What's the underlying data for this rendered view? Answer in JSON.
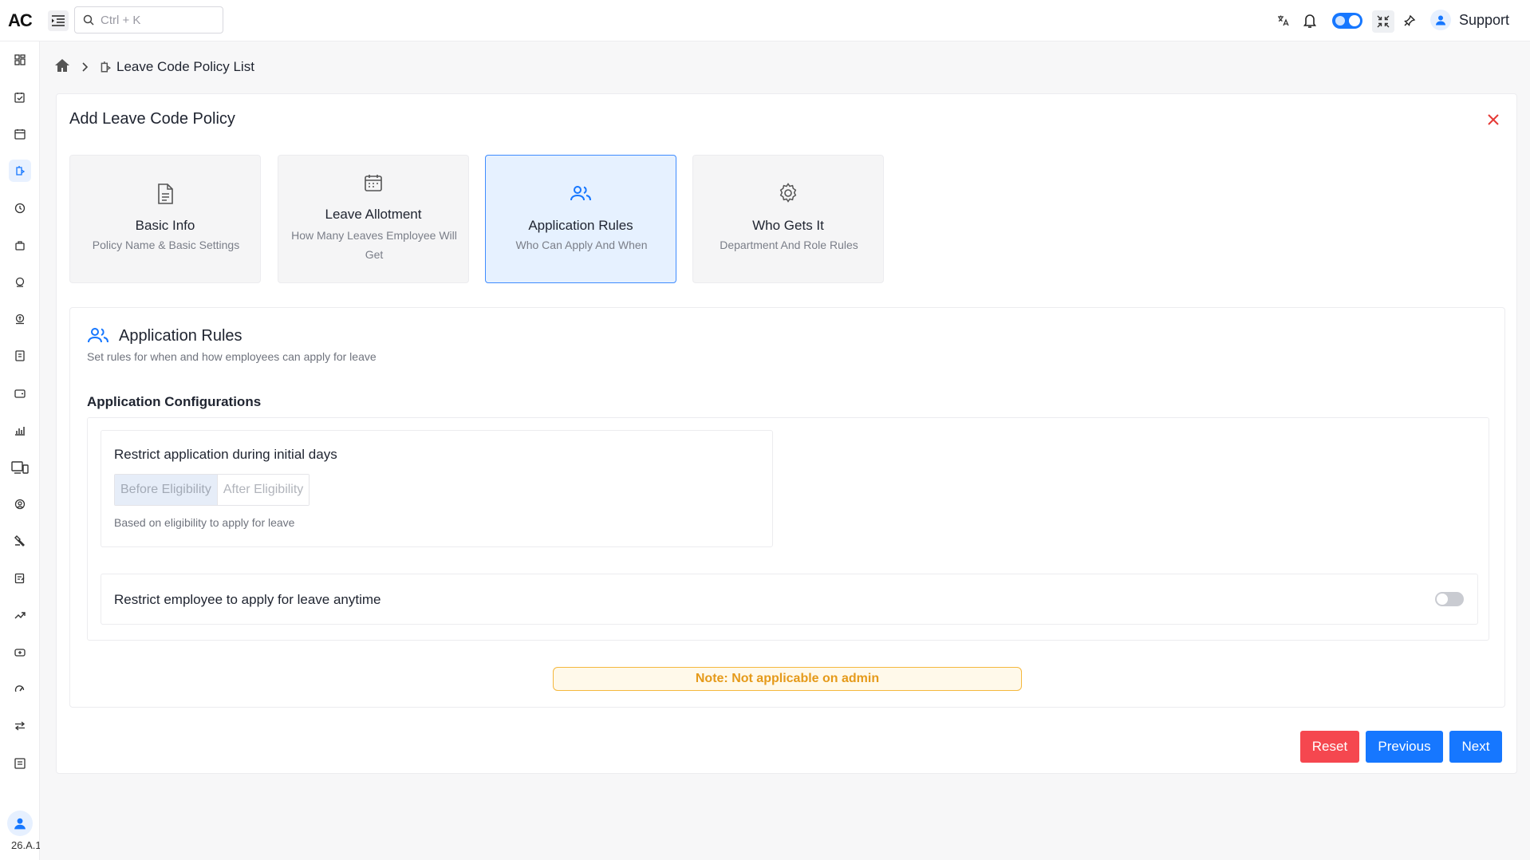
{
  "app": {
    "logo": "AC"
  },
  "topbar": {
    "search_placeholder": "Ctrl + K",
    "user_name": "Support",
    "icons": [
      "menu-icon",
      "search-icon",
      "translate-icon",
      "bell-icon",
      "theme-toggle",
      "fullscreen-icon",
      "pin-icon",
      "user-icon"
    ]
  },
  "sidebar": {
    "version": "26.A.1",
    "items": [
      "dashboard-icon",
      "attendance-icon",
      "calendar-icon",
      "leave-icon",
      "clock-icon",
      "bag-icon",
      "payroll-icon",
      "loan-icon",
      "report-icon",
      "wallet-icon",
      "chart-icon",
      "devices-icon",
      "profile-icon",
      "tools-icon",
      "notes-icon",
      "performance-icon",
      "assets-icon",
      "speed-icon",
      "transfer-icon",
      "inbox-icon"
    ]
  },
  "breadcrumb": {
    "current": "Leave Code Policy List"
  },
  "page": {
    "title": "Add Leave Code Policy"
  },
  "steps": [
    {
      "title": "Basic Info",
      "sub": "Policy Name & Basic Settings"
    },
    {
      "title": "Leave Allotment",
      "sub": "How Many Leaves Employee Will Get"
    },
    {
      "title": "Application Rules",
      "sub": "Who Can Apply And When"
    },
    {
      "title": "Who Gets It",
      "sub": "Department And Role Rules"
    }
  ],
  "section": {
    "title": "Application Rules",
    "subtitle": "Set rules for when and how employees can apply for leave",
    "config_title": "Application Configurations",
    "rule1": {
      "title": "Restrict application during initial days",
      "options": [
        "Before Eligibility",
        "After Eligibility"
      ],
      "selected": "Before Eligibility",
      "help": "Based on eligibility to apply for leave"
    },
    "rule2": {
      "label": "Restrict employee to apply for leave anytime",
      "enabled": false
    },
    "note": "Note: Not applicable on admin"
  },
  "actions": {
    "reset": "Reset",
    "previous": "Previous",
    "next": "Next"
  },
  "colors": {
    "primary": "#1677ff",
    "danger": "#f5474f",
    "warning": "#f5b83d",
    "active_step_bg": "#e6f1ff"
  }
}
